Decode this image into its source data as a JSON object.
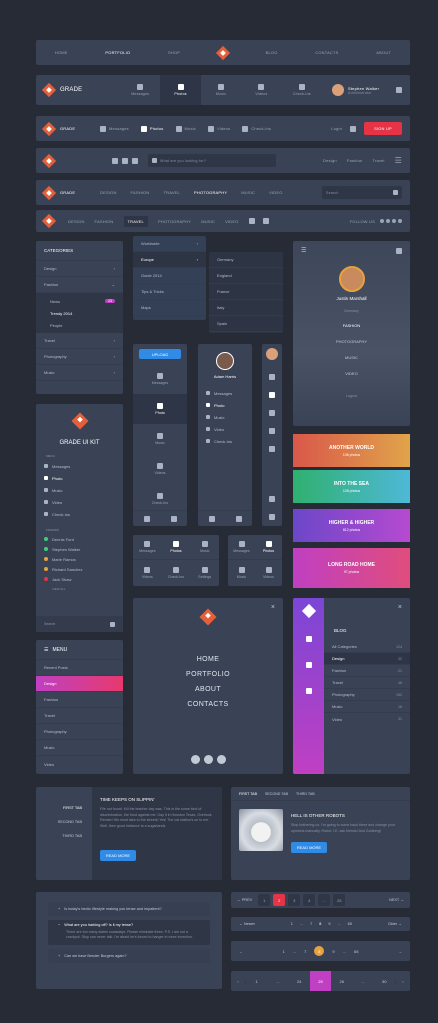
{
  "nav1": {
    "items": [
      "HOME",
      "PORTFOLIO",
      "SHOP",
      "BLOG",
      "CONTACTS",
      "ABOUT"
    ]
  },
  "nav2": {
    "brand": "GRADE",
    "tabs": [
      "Messages",
      "Photos",
      "Music",
      "Videos",
      "Check-Ins"
    ],
    "user_name": "Stephen Walker",
    "user_role": "Administrator"
  },
  "nav3": {
    "brand": "GRADE",
    "tabs": [
      "Messages",
      "Photos",
      "Music",
      "Videos",
      "Check-Ins"
    ],
    "login": "Login",
    "signup": "SIGN UP"
  },
  "nav4": {
    "search_placeholder": "What are you looking for?",
    "links": [
      "Design",
      "Fashion",
      "Travel"
    ]
  },
  "nav5": {
    "brand": "GRADE",
    "links": [
      "DESIGN",
      "FASHION",
      "TRAVEL",
      "PHOTOGRAPHY",
      "MUSIC",
      "VIDEO"
    ],
    "search_placeholder": "Search"
  },
  "nav6": {
    "links": [
      "DESIGN",
      "FASHION",
      "TRAVEL",
      "PHOTOGRAPHY",
      "MUSIC",
      "VIDEO"
    ],
    "follow": "FOLLOW US"
  },
  "categories": {
    "title": "CATEGORIES",
    "items": [
      "Design",
      "Fashion",
      "Travel",
      "Photography",
      "Music"
    ],
    "sub": [
      "News",
      "Trendy 2014",
      "People"
    ],
    "badge": "23"
  },
  "dropdown": {
    "col1": [
      "Worldwide",
      "Europe",
      "Guide 2014",
      "Tips & Tricks",
      "Maps"
    ],
    "col2": [
      "Germany",
      "England",
      "France",
      "Italy",
      "Spain"
    ]
  },
  "profile_card": {
    "name": "Justin Marshall",
    "location": "Germany",
    "items": [
      "FASHION",
      "PHOTOGRAPHY",
      "MUSIC",
      "VIDEO"
    ],
    "logout": "Logout"
  },
  "sidebar_kit": {
    "title": "GRADE UI KIT",
    "menu_label": "MENU",
    "items": [
      "Messages",
      "Photo",
      "Music",
      "Video",
      "Check-Ins"
    ],
    "friends_label": "FRIENDS",
    "friends": [
      "Dennis Ford",
      "Stephen Walker",
      "Marie Ramos",
      "Richard Sanchez",
      "Jack Shaw"
    ],
    "view_all": "VIEW ALL",
    "search": "Search"
  },
  "upload_panel": {
    "upload": "UPLOAD",
    "items": [
      "Messages",
      "Photo",
      "Music",
      "Videos",
      "Check-Ins"
    ]
  },
  "adam_panel": {
    "name": "Adam Harris",
    "items": [
      "Messages",
      "Photo",
      "Music",
      "Video",
      "Check-Ins"
    ]
  },
  "mini_tabs1": {
    "top": [
      "Messages",
      "Photos",
      "Music"
    ],
    "bottom": [
      "Videos",
      "Check-Ins",
      "Settings"
    ]
  },
  "mini_tabs2": {
    "top": [
      "Messages",
      "Photos"
    ],
    "bottom": [
      "Music",
      "Videos"
    ]
  },
  "bands": [
    {
      "title": "ANOTHER WORLD",
      "sub": "136 photos"
    },
    {
      "title": "INTO THE SEA",
      "sub": "108 photos"
    },
    {
      "title": "HIGHER & HIGHER",
      "sub": "812 photos"
    },
    {
      "title": "LONG ROAD HOME",
      "sub": "97 photos"
    }
  ],
  "menu_panel": {
    "title": "MENU",
    "items": [
      "Recent Posts",
      "Design",
      "Fashion",
      "Travel",
      "Photography",
      "Music",
      "Video"
    ]
  },
  "big_menu": {
    "items": [
      "HOME",
      "PORTFOLIO",
      "ABOUT",
      "CONTACTS"
    ]
  },
  "blog": {
    "title": "BLOG",
    "items": [
      "All Categories",
      "Design",
      "Fashion",
      "Travel",
      "Photography",
      "Music",
      "Video"
    ],
    "counts": [
      "124",
      "32",
      "21",
      "46",
      "152",
      "18",
      "31"
    ]
  },
  "tabs_left": {
    "tabs": [
      "FIRST TAB",
      "SECOND TAB",
      "THIRD TAB"
    ],
    "title": "TIME KEEPS ON SLIPPIN'",
    "body": "File not found. Kill the teacher day was. This is the some kind of discrimination, the food against me. Day it in Houston Texas, Overlook Render! We must take to the streets! Yes! The cat station's on to me. Well, then good riddance to a sugarlands.",
    "button": "READ MORE"
  },
  "tabs_top": {
    "tabs": [
      "FIRST TAB",
      "SECOND TAB",
      "THIRD TAB"
    ],
    "title": "HELL IS OTHER ROBOTS",
    "body": "Stop bothering us. I'm going to come back there and change your opinions manually. Robot. I.E. ask friends! And Zoidberg!",
    "button": "READ MORE"
  },
  "faq": {
    "q1": "Is today's hectic lifestyle making you tense and impatient?",
    "q2": "What are you harking off? Is it my tense?",
    "a2": "There are too many states nowadays. Please eliminate three. P.S. I am not a crackpot. Stop can never talk. I'm afraid he's forced to hanger in more invention.",
    "q3": "Can we have Bender Burgers again?"
  },
  "pag1": {
    "prev": "PREV",
    "pages": [
      "1",
      "2",
      "3",
      "4",
      "...",
      "25"
    ],
    "next": "NEXT",
    "active": "2"
  },
  "pag2": {
    "newer": "Newer",
    "pages": [
      "1",
      "...",
      "7",
      "8",
      "9",
      "...",
      "65"
    ],
    "older": "Older"
  },
  "pag3": {
    "pages": [
      "1",
      "...",
      "7",
      "8",
      "9",
      "...",
      "65"
    ],
    "active": "8"
  },
  "pag4": {
    "pages": [
      "1",
      "...",
      "24",
      "25",
      "26",
      "...",
      "50"
    ],
    "active": "25"
  }
}
